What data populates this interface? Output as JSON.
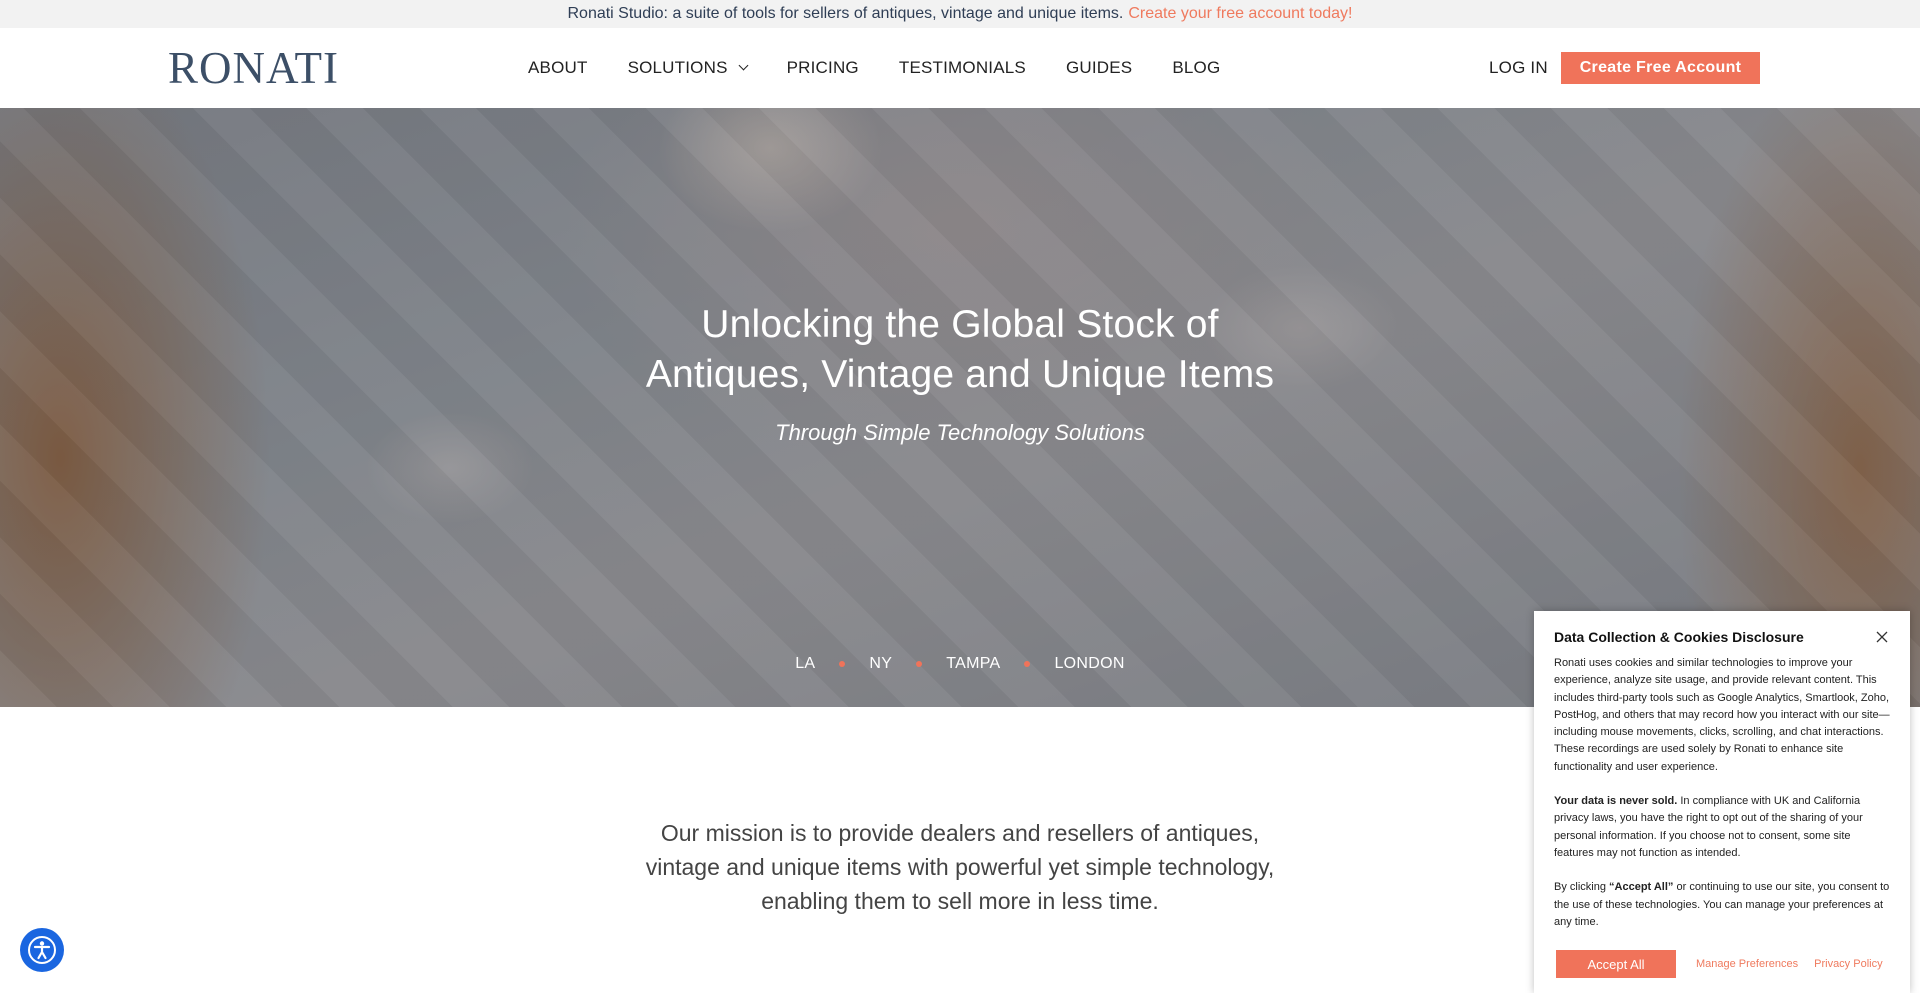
{
  "banner": {
    "text": "Ronati Studio: a suite of tools for sellers of antiques, vintage and unique items.",
    "cta": "Create your free account today!"
  },
  "header": {
    "logo": "RONATI",
    "nav": [
      {
        "label": "ABOUT"
      },
      {
        "label": "SOLUTIONS",
        "has_dropdown": true
      },
      {
        "label": "PRICING"
      },
      {
        "label": "TESTIMONIALS"
      },
      {
        "label": "GUIDES"
      },
      {
        "label": "BLOG"
      }
    ],
    "login": "LOG IN",
    "create_account": "Create Free Account"
  },
  "hero": {
    "title_line1": "Unlocking the Global Stock of",
    "title_line2": "Antiques, Vintage and Unique Items",
    "subtitle": "Through Simple Technology Solutions",
    "cities": [
      "LA",
      "NY",
      "TAMPA",
      "LONDON"
    ]
  },
  "mission": {
    "line1": "Our mission is to provide dealers and resellers of antiques,",
    "line2": "vintage and unique items with powerful yet simple technology,",
    "line3": "enabling them to sell more in less time."
  },
  "cookie": {
    "title": "Data Collection & Cookies Disclosure",
    "para1": "Ronati uses cookies and similar technologies to improve your experience, analyze site usage, and provide relevant content. This includes third-party tools such as Google Analytics, Smartlook, Zoho, PostHog, and others that may record how you interact with our site—including mouse movements, clicks, scrolling, and chat interactions. These recordings are used solely by Ronati to enhance site functionality and user experience.",
    "para2_bold": "Your data is never sold.",
    "para2_rest": " In compliance with UK and California privacy laws, you have the right to opt out of the sharing of your personal information. If you choose not to consent, some site features may not function as intended.",
    "para3_start": "By clicking ",
    "para3_bold": "“Accept All”",
    "para3_rest": " or continuing to use our site, you consent to the use of these technologies. You can manage your preferences at any time.",
    "accept": "Accept All",
    "manage": "Manage Preferences",
    "privacy": "Privacy Policy"
  },
  "colors": {
    "accent": "#f0735a",
    "logo": "#3c4f67",
    "accessibility": "#1a66e0"
  },
  "icons": [
    "chevron-down-icon",
    "close-icon",
    "accessibility-icon"
  ]
}
